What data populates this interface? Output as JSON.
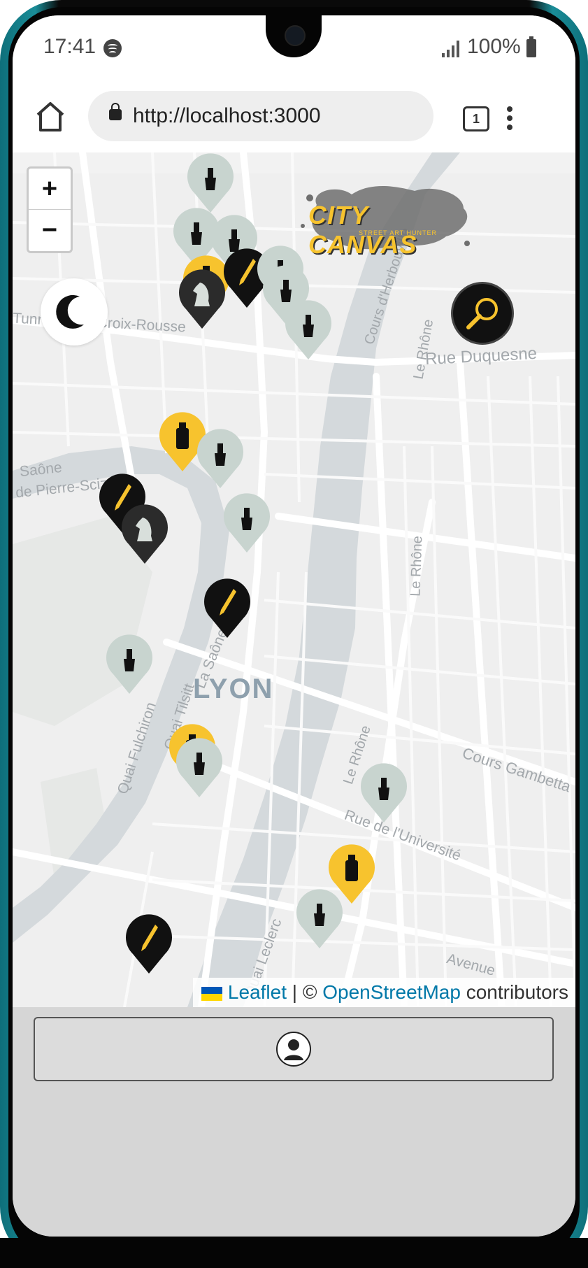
{
  "status_bar": {
    "time": "17:41",
    "battery_percent": "100%",
    "music_app_icon": "spotify-icon",
    "signal_icon": "signal-icon",
    "battery_icon": "battery-icon"
  },
  "browser": {
    "url": "http://localhost:3000",
    "tab_count": "1",
    "home_icon": "home-icon",
    "lock_icon": "lock-icon",
    "menu_icon": "more-vertical-icon"
  },
  "map": {
    "zoom_in_label": "+",
    "zoom_out_label": "−",
    "city_label": "LYON",
    "street_labels": [
      "Tunnel de la Croix-Rousse",
      "Rue Duquesne",
      "Cours d'Herbouville",
      "Le Rhône",
      "Le Rhône",
      "Le Rhône",
      "Saône",
      "de Pierre-Scize",
      "La Saône",
      "Quai Tilsitt",
      "Quai Fulchiron",
      "Cours Gambetta",
      "Rue de l'Université",
      "Quai Leclerc",
      "Avenue"
    ],
    "dark_mode_icon": "moon-icon",
    "search_icon": "magnifier-icon",
    "logo": {
      "title": "CITY CANVAS",
      "subtitle": "STREET ART HUNTER"
    },
    "marker_colors": {
      "yellow": "#f7c32e",
      "black": "#111111",
      "grey": "#c8d4cf",
      "dark": "#2b2b2b"
    },
    "markers": [
      {
        "type": "brush",
        "color": "grey"
      },
      {
        "type": "brush",
        "color": "grey"
      },
      {
        "type": "brush",
        "color": "grey"
      },
      {
        "type": "spray",
        "color": "yellow"
      },
      {
        "type": "knight",
        "color": "dark"
      },
      {
        "type": "pen",
        "color": "black"
      },
      {
        "type": "brush",
        "color": "grey"
      },
      {
        "type": "brush",
        "color": "grey"
      },
      {
        "type": "brush",
        "color": "grey"
      },
      {
        "type": "spray",
        "color": "yellow"
      },
      {
        "type": "brush",
        "color": "grey"
      },
      {
        "type": "pen",
        "color": "black"
      },
      {
        "type": "knight",
        "color": "dark"
      },
      {
        "type": "brush",
        "color": "grey"
      },
      {
        "type": "pen",
        "color": "black"
      },
      {
        "type": "brush",
        "color": "grey"
      },
      {
        "type": "spray",
        "color": "yellow"
      },
      {
        "type": "brush",
        "color": "grey"
      },
      {
        "type": "brush",
        "color": "grey"
      },
      {
        "type": "spray",
        "color": "yellow"
      },
      {
        "type": "brush",
        "color": "grey"
      },
      {
        "type": "pen",
        "color": "black"
      }
    ],
    "attribution": {
      "leaflet": "Leaflet",
      "separator": "| ©",
      "osm": "OpenStreetMap",
      "contributors": "contributors"
    }
  },
  "bottom_nav": {
    "profile_icon": "user-profile-icon"
  }
}
